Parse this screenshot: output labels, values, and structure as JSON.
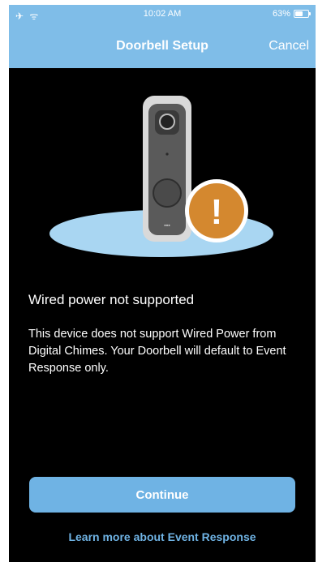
{
  "status_bar": {
    "left_icons": "✈ ᯤ",
    "time": "10:02 AM",
    "battery_text": "63%",
    "battery_level": 0.63
  },
  "nav": {
    "title": "Doorbell Setup",
    "cancel_label": "Cancel"
  },
  "message": {
    "heading": "Wired power not supported",
    "body": "This device does not support Wired Power from Digital Chimes. Your Doorbell will default to Event Response only.",
    "warning_symbol": "!"
  },
  "actions": {
    "continue_label": "Continue",
    "learn_more_label": "Learn more about Event Response"
  },
  "colors": {
    "header_bg": "#7fbde8",
    "button_bg": "#6fb3e4",
    "warning": "#d4882f",
    "platform": "#a9d6f2"
  },
  "icons": {
    "status_left": [
      "airplane-icon",
      "wifi-icon"
    ],
    "battery": "battery-icon",
    "warning": "exclamation-icon"
  }
}
